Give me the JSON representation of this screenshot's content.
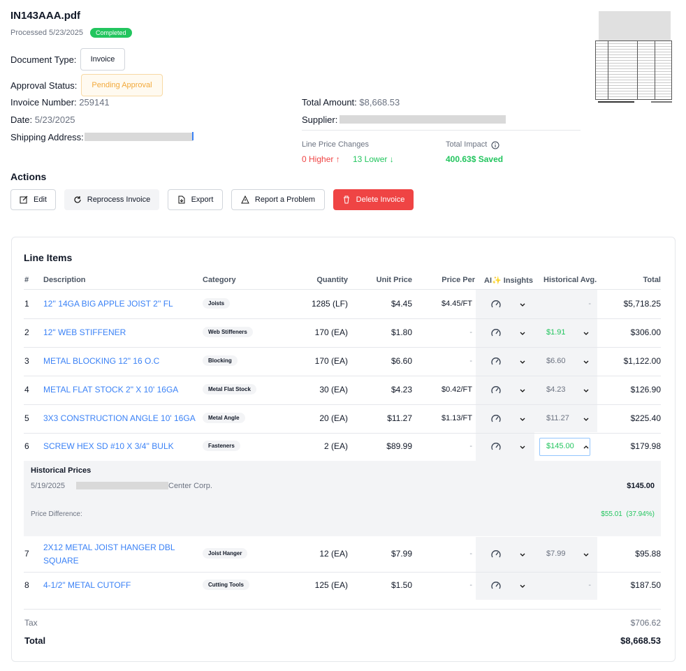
{
  "doc": {
    "filename": "IN143AAA.pdf",
    "processed": "Processed 5/23/2025",
    "status_badge": "Completed",
    "doc_type_label": "Document Type:",
    "doc_type_value": "Invoice",
    "approval_label": "Approval Status:",
    "approval_value": "Pending Approval",
    "invoice_number_label": "Invoice Number:",
    "invoice_number": "259141",
    "date_label": "Date:",
    "date": "5/23/2025",
    "shipping_label": "Shipping Address:",
    "total_amount_label": "Total Amount:",
    "total_amount": "$8,668.53",
    "supplier_label": "Supplier:"
  },
  "impact": {
    "line_changes_label": "Line Price Changes",
    "higher": "0 Higher ↑",
    "lower": "13 Lower ↓",
    "total_impact_label": "Total Impact",
    "saved": "400.63$ Saved"
  },
  "actions": {
    "title": "Actions",
    "edit": "Edit",
    "reprocess": "Reprocess Invoice",
    "export": "Export",
    "report": "Report a Problem",
    "delete": "Delete Invoice"
  },
  "table": {
    "title": "Line Items",
    "headers": {
      "num": "#",
      "description": "Description",
      "category": "Category",
      "quantity": "Quantity",
      "unit_price": "Unit Price",
      "price_per": "Price Per",
      "ai": "AI",
      "insights": "Insights",
      "hist": "Historical Avg.",
      "total": "Total"
    },
    "rows": [
      {
        "num": "1",
        "desc": "12'' 14GA BIG APPLE JOIST 2'' FL",
        "desc2": "",
        "cat": "Joists",
        "qty": "1285 (LF)",
        "unit": "$4.45",
        "per": "$4.45/FT",
        "hist": "-",
        "total": "$5,718.25"
      },
      {
        "num": "2",
        "desc": "12\" WEB STIFFENER",
        "desc2": "",
        "cat": "Web Stiffeners",
        "qty": "170 (EA)",
        "unit": "$1.80",
        "per": "-",
        "hist": "$1.91",
        "total": "$306.00"
      },
      {
        "num": "3",
        "desc": "METAL BLOCKING 12\" 16 O.C",
        "desc2": "",
        "cat": "Blocking",
        "qty": "170 (EA)",
        "unit": "$6.60",
        "per": "-",
        "hist": "$6.60",
        "total": "$1,122.00"
      },
      {
        "num": "4",
        "desc": "METAL FLAT STOCK 2\" X 10' 16GA",
        "desc2": "",
        "cat": "Metal Flat Stock",
        "qty": "30 (EA)",
        "unit": "$4.23",
        "per": "$0.42/FT",
        "hist": "$4.23",
        "total": "$126.90"
      },
      {
        "num": "5",
        "desc": "3X3 CONSTRUCTION ANGLE 10' 16GA",
        "desc2": "",
        "cat": "Metal Angle",
        "qty": "20 (EA)",
        "unit": "$11.27",
        "per": "$1.13/FT",
        "hist": "$11.27",
        "total": "$225.40"
      },
      {
        "num": "6",
        "desc": "SCREW HEX SD #10 X 3/4'' BULK",
        "desc2": "",
        "cat": "Fasteners",
        "qty": "2 (EA)",
        "unit": "$89.99",
        "per": "-",
        "hist": "$145.00",
        "total": "$179.98"
      },
      {
        "num": "7",
        "desc": "2X12 METAL JOIST HANGER DBL",
        "desc2": "SQUARE",
        "cat": "Joist Hanger",
        "qty": "12 (EA)",
        "unit": "$7.99",
        "per": "-",
        "hist": "$7.99",
        "total": "$95.88"
      },
      {
        "num": "8",
        "desc": "4-1/2\" METAL CUTOFF",
        "desc2": "",
        "cat": "Cutting Tools",
        "qty": "125 (EA)",
        "unit": "$1.50",
        "per": "-",
        "hist": "-",
        "total": "$187.50"
      }
    ],
    "history": {
      "title": "Historical Prices",
      "date": "5/19/2025",
      "supplier_suffix": "Center Corp.",
      "price": "$145.00",
      "diff_label": "Price Difference:",
      "diff_value": "$55.01  (37.94%)"
    },
    "tax_label": "Tax",
    "tax_value": "$706.62",
    "total_label": "Total",
    "total_value": "$8,668.53"
  },
  "colors": {
    "link": "#3b82f6",
    "green": "#22c55e",
    "red": "#ef4444",
    "pending": "#f2a93b"
  }
}
